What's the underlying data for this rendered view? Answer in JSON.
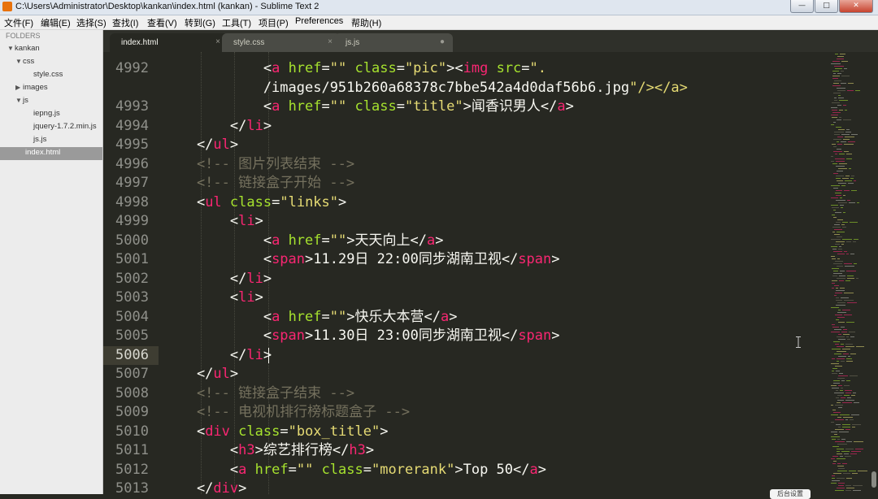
{
  "window": {
    "title": "C:\\Users\\Administrator\\Desktop\\kankan\\index.html (kankan) - Sublime Text 2"
  },
  "menu": [
    "文件(F)",
    "编辑(E)",
    "选择(S)",
    "查找(I)",
    "查看(V)",
    "转到(G)",
    "工具(T)",
    "项目(P)",
    "Preferences",
    "帮助(H)"
  ],
  "sidebar": {
    "header": "FOLDERS",
    "root": "kankan",
    "items": [
      "css",
      "style.css",
      "images",
      "js",
      "iepng.js",
      "jquery-1.7.2.min.js",
      "js.js",
      "index.html"
    ]
  },
  "tabs": [
    {
      "label": "index.html",
      "close": "×"
    },
    {
      "label": "style.css",
      "close": "×"
    },
    {
      "label": "js.js",
      "close": "●"
    }
  ],
  "line_numbers": [
    "4992",
    "",
    "4993",
    "4994",
    "4995",
    "4996",
    "4997",
    "4998",
    "4999",
    "5000",
    "5001",
    "5002",
    "5003",
    "5004",
    "5005",
    "5006",
    "5007",
    "5008",
    "5009",
    "5010",
    "5011",
    "5012",
    "5013"
  ],
  "code": [
    "            <a href=\"\" class=\"pic\"><img src=\".",
    "            /images/951b260a68378c7bbe542a4d0daf56b6.jpg\"/></a>",
    "            <a href=\"\" class=\"title\">闻香识男人</a>",
    "        </li>",
    "    </ul>",
    "    <!-- 图片列表结束 -->",
    "    <!-- 链接盒子开始 -->",
    "    <ul class=\"links\">",
    "        <li>",
    "            <a href=\"\">天天向上</a>",
    "            <span>11.29日 22:00同步湖南卫视</span>",
    "        </li>",
    "        <li>",
    "            <a href=\"\">快乐大本营</a>",
    "            <span>11.30日 23:00同步湖南卫视</span>",
    "        </li>",
    "    </ul>",
    "    <!-- 链接盒子结束 -->",
    "    <!-- 电视机排行榜标题盒子 -->",
    "    <div class=\"box_title\">",
    "        <h3>综艺排行榜</h3>",
    "        <a href=\"\" class=\"morerank\">Top 50</a>",
    "    </div>"
  ],
  "current_line": "5006",
  "tooltip": "后台设置",
  "window_buttons": [
    "—",
    "□",
    "✕"
  ],
  "colors": {
    "tag": "#f92672",
    "attr": "#a6e22e",
    "string": "#e6db74",
    "comment": "#75715e",
    "text": "#f8f8f2",
    "background": "#272822"
  }
}
